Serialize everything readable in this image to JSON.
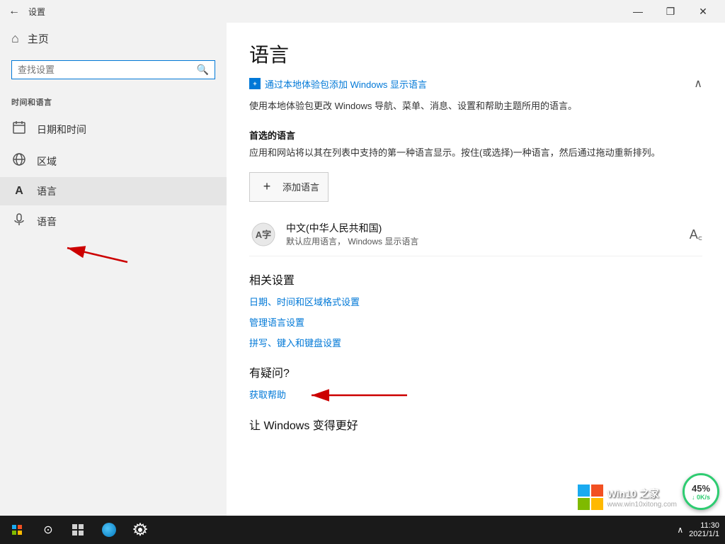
{
  "titlebar": {
    "back_label": "←",
    "title": "设置",
    "minimize": "—",
    "restore": "❐",
    "close": "✕"
  },
  "sidebar": {
    "home_label": "主页",
    "search_placeholder": "查找设置",
    "section_title": "时间和语言",
    "items": [
      {
        "id": "datetime",
        "label": "日期和时间",
        "icon": "🗓"
      },
      {
        "id": "region",
        "label": "区域",
        "icon": "🌐"
      },
      {
        "id": "language",
        "label": "语言",
        "icon": "A"
      },
      {
        "id": "speech",
        "label": "语音",
        "icon": "🎤"
      }
    ]
  },
  "content": {
    "page_title": "语言",
    "top_link": "通过本地体验包添加 Windows 显示语言",
    "description": "使用本地体验包更改 Windows 导航、菜单、消息、设置和帮助主题所用的语言。",
    "preferred_section_title": "首选的语言",
    "preferred_description": "应用和网站将以其在列表中支持的第一种语言显示。按住(或选择)一种语言，然后通过拖动重新排列。",
    "add_lang_label": "添加语言",
    "language_item": {
      "name": "中文(中华人民共和国)",
      "status": "默认应用语言，  Windows 显示语言"
    },
    "related_settings_title": "相关设置",
    "related_links": [
      "日期、时间和区域格式设置",
      "管理语言设置",
      "拼写、键入和键盘设置"
    ],
    "faq_title": "有疑问?",
    "faq_link": "获取帮助",
    "improve_title": "让 Windows 变得更好"
  },
  "taskbar": {
    "time": "11:30",
    "date": "2021/1/1",
    "chevron": "∧"
  },
  "speed_badge": {
    "percent": "45%",
    "speed": "↓ 0K/s"
  },
  "win10_brand": {
    "text": "Win10 之家",
    "sub": "www.win10xitong.com"
  }
}
